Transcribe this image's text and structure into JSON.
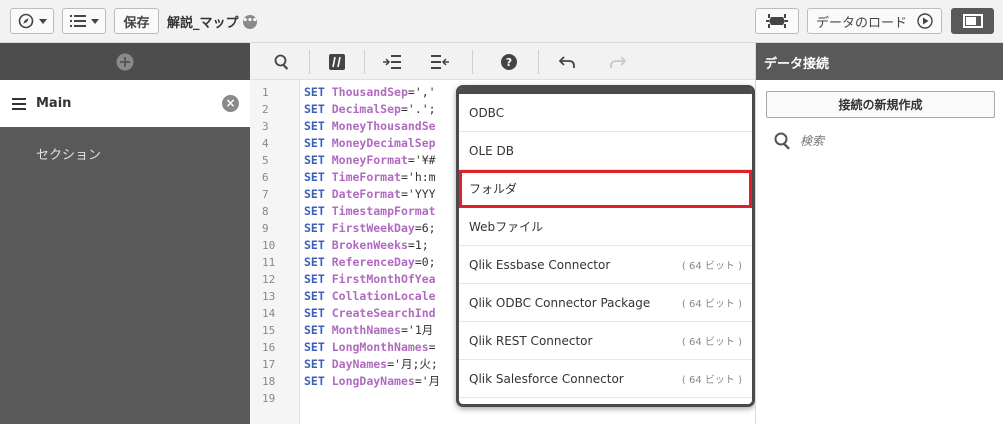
{
  "toolbar": {
    "save_label": "保存",
    "app_title": "解説_マップ",
    "load_data_label": "データのロード"
  },
  "left": {
    "section_name": "Main",
    "section_label": "セクション"
  },
  "editor": {
    "line_numbers": [
      "1",
      "2",
      "3",
      "4",
      "5",
      "6",
      "7",
      "8",
      "9",
      "10",
      "11",
      "12",
      "13",
      "14",
      "15",
      "16",
      "17",
      "18",
      "19"
    ],
    "lines": [
      {
        "kw": "SET",
        "var": "ThousandSep",
        "rest": "=','"
      },
      {
        "kw": "SET",
        "var": "DecimalSep",
        "rest": "='.';"
      },
      {
        "kw": "SET",
        "var": "MoneyThousandSe",
        "rest": ""
      },
      {
        "kw": "SET",
        "var": "MoneyDecimalSep",
        "rest": ""
      },
      {
        "kw": "SET",
        "var": "MoneyFormat",
        "rest": "='¥#"
      },
      {
        "kw": "SET",
        "var": "TimeFormat",
        "rest": "='h:m"
      },
      {
        "kw": "SET",
        "var": "DateFormat",
        "rest": "='YYY"
      },
      {
        "kw": "SET",
        "var": "TimestampFormat",
        "rest": ""
      },
      {
        "kw": "SET",
        "var": "FirstWeekDay",
        "rest": "=6;"
      },
      {
        "kw": "SET",
        "var": "BrokenWeeks",
        "rest": "=1;"
      },
      {
        "kw": "SET",
        "var": "ReferenceDay",
        "rest": "=0;"
      },
      {
        "kw": "SET",
        "var": "FirstMonthOfYea",
        "rest": ""
      },
      {
        "kw": "SET",
        "var": "CollationLocale",
        "rest": ""
      },
      {
        "kw": "SET",
        "var": "CreateSearchInd",
        "rest": ""
      },
      {
        "kw": "SET",
        "var": "MonthNames",
        "rest": "='1月"
      },
      {
        "kw": "SET",
        "var": "LongMonthNames",
        "rest": "="
      },
      {
        "kw": "SET",
        "var": "DayNames",
        "rest": "='月;火;"
      },
      {
        "kw": "SET",
        "var": "LongDayNames",
        "rest": "='月"
      }
    ]
  },
  "dropdown": {
    "items": [
      {
        "label": "ODBC",
        "bit": ""
      },
      {
        "label": "OLE DB",
        "bit": ""
      },
      {
        "label": "フォルダ",
        "bit": ""
      },
      {
        "label": "Webファイル",
        "bit": ""
      },
      {
        "label": "Qlik Essbase Connector",
        "bit": "( 64 ビット )"
      },
      {
        "label": "Qlik ODBC Connector Package",
        "bit": "( 64 ビット )"
      },
      {
        "label": "Qlik REST Connector",
        "bit": "( 64 ビット )"
      },
      {
        "label": "Qlik Salesforce Connector",
        "bit": "( 64 ビット )"
      }
    ],
    "highlight_color": "#e0202a"
  },
  "right": {
    "title": "データ接続",
    "new_connection_label": "接続の新規作成",
    "search_placeholder": "検索"
  }
}
